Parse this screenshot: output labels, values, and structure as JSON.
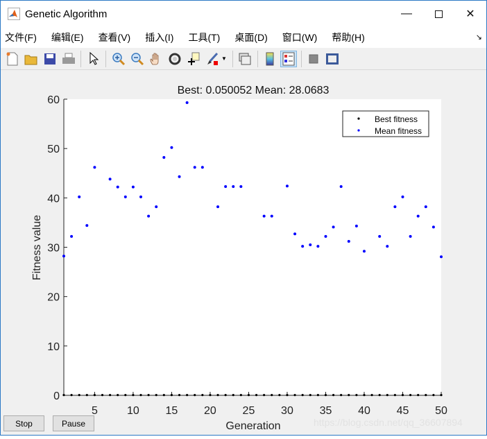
{
  "window": {
    "title": "Genetic Algorithm",
    "controls": [
      "minimize",
      "maximize",
      "close"
    ]
  },
  "menu": [
    "文件(F)",
    "编辑(E)",
    "查看(V)",
    "插入(I)",
    "工具(T)",
    "桌面(D)",
    "窗口(W)",
    "帮助(H)"
  ],
  "toolbar": [
    "new-file-icon",
    "open-folder-icon",
    "save-icon",
    "print-icon",
    "pointer-icon",
    "zoom-in-icon",
    "zoom-out-icon",
    "pan-hand-icon",
    "rotate-3d-icon",
    "data-cursor-icon",
    "brush-icon",
    "link-plot-icon",
    "colorbar-icon",
    "legend-icon",
    "hide-plot-tools-icon",
    "show-plot-tools-icon"
  ],
  "buttons": {
    "stop": "Stop",
    "pause": "Pause"
  },
  "watermark": "https://blog.csdn.net/qq_36607894",
  "chart_data": {
    "type": "scatter",
    "title": "Best: 0.050052 Mean: 28.0683",
    "xlabel": "Generation",
    "ylabel": "Fitness value",
    "xlim": [
      1,
      50
    ],
    "ylim": [
      0,
      60
    ],
    "xticks": [
      5,
      10,
      15,
      20,
      25,
      30,
      35,
      40,
      45,
      50
    ],
    "yticks": [
      0,
      10,
      20,
      30,
      40,
      50,
      60
    ],
    "grid": false,
    "legend_placement": "top-right",
    "x": [
      1,
      2,
      3,
      4,
      5,
      6,
      7,
      8,
      9,
      10,
      11,
      12,
      13,
      14,
      15,
      16,
      17,
      18,
      19,
      20,
      21,
      22,
      23,
      24,
      25,
      26,
      27,
      28,
      29,
      30,
      31,
      32,
      33,
      34,
      35,
      36,
      37,
      38,
      39,
      40,
      41,
      42,
      43,
      44,
      45,
      46,
      47,
      48,
      49,
      50
    ],
    "series": [
      {
        "name": "Best fitness",
        "color": "#000000",
        "values": [
          0.05,
          0.05,
          0.05,
          0.05,
          0.05,
          0.05,
          0.05,
          0.05,
          0.05,
          0.05,
          0.05,
          0.05,
          0.05,
          0.05,
          0.05,
          0.05,
          0.05,
          0.05,
          0.05,
          0.05,
          0.05,
          0.05,
          0.05,
          0.05,
          0.05,
          0.05,
          0.05,
          0.05,
          0.05,
          0.05,
          0.05,
          0.05,
          0.05,
          0.05,
          0.05,
          0.05,
          0.05,
          0.05,
          0.05,
          0.05,
          0.05,
          0.05,
          0.05,
          0.05,
          0.05,
          0.05,
          0.05,
          0.05,
          0.05,
          0.050052
        ]
      },
      {
        "name": "Mean fitness",
        "color": "#0000ff",
        "values": [
          28.2,
          32.2,
          40.2,
          34.4,
          46.2,
          null,
          43.8,
          42.2,
          40.2,
          42.2,
          40.2,
          36.3,
          38.2,
          48.2,
          50.2,
          44.3,
          59.3,
          46.2,
          46.2,
          null,
          38.2,
          42.3,
          42.3,
          42.3,
          null,
          null,
          36.3,
          36.3,
          null,
          42.4,
          32.7,
          30.2,
          30.5,
          30.2,
          32.2,
          34.1,
          42.3,
          31.2,
          34.3,
          29.2,
          null,
          32.2,
          30.2,
          38.2,
          40.2,
          32.2,
          36.3,
          38.2,
          34.1,
          28.0683
        ]
      }
    ]
  }
}
